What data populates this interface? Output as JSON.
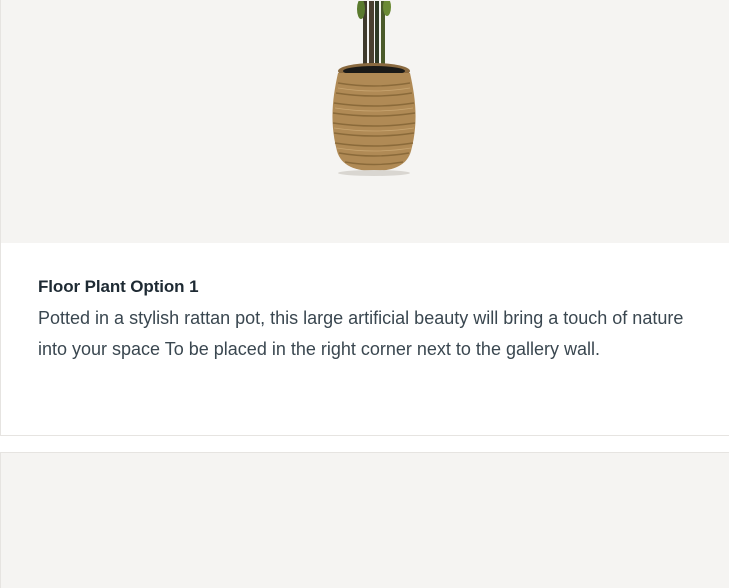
{
  "products": [
    {
      "title": "Floor Plant Option 1",
      "description": "Potted in a stylish rattan pot, this large artificial beauty will bring a touch of nature into your space To be placed in the right corner next to the gallery wall.",
      "image_icon": "potted-plant-rattan-image"
    }
  ],
  "colors": {
    "image_background": "#f5f4f2",
    "title": "#1e2a33",
    "text": "#3a4750",
    "border": "#e6e4e1"
  }
}
